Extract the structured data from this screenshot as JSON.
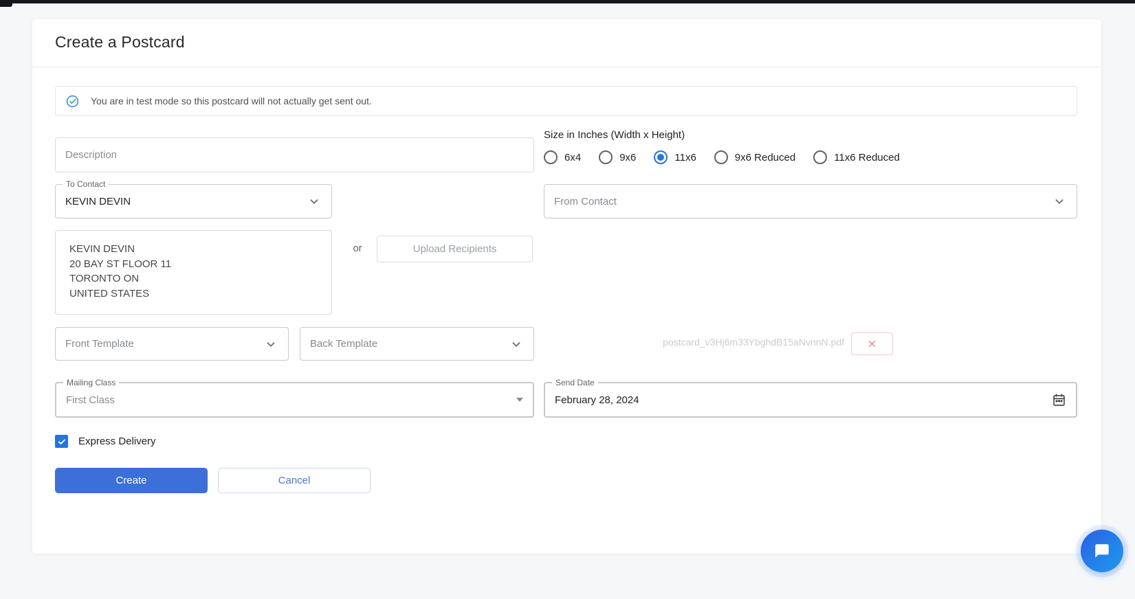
{
  "page": {
    "title": "Create a Postcard"
  },
  "alert": {
    "text": "You are in test mode so this postcard will not actually get sent out."
  },
  "description": {
    "placeholder": "Description"
  },
  "size": {
    "label": "Size in Inches (Width x Height)",
    "options": [
      {
        "label": "6x4",
        "selected": false
      },
      {
        "label": "9x6",
        "selected": false
      },
      {
        "label": "11x6",
        "selected": true
      },
      {
        "label": "9x6 Reduced",
        "selected": false
      },
      {
        "label": "11x6 Reduced",
        "selected": false
      }
    ]
  },
  "to_contact": {
    "label": "To Contact",
    "value": "KEVIN DEVIN"
  },
  "from_contact": {
    "placeholder": "From Contact"
  },
  "recipient_preview": {
    "lines": [
      "KEVIN DEVIN",
      "20 BAY ST FLOOR 11",
      "TORONTO ON",
      "UNITED STATES"
    ]
  },
  "or_label": "or",
  "upload_recipients": {
    "label": "Upload Recipients"
  },
  "front_template": {
    "placeholder": "Front Template"
  },
  "back_template": {
    "placeholder": "Back Template"
  },
  "uploaded_file": {
    "name": "postcard_v3Hj6m33YbghdB15aNvnnN.pdf"
  },
  "mailing_class": {
    "label": "Mailing Class",
    "value": "First Class"
  },
  "send_date": {
    "label": "Send Date",
    "value": "February 28, 2024"
  },
  "express_delivery": {
    "label": "Express Delivery",
    "checked": true
  },
  "actions": {
    "create": "Create",
    "cancel": "Cancel"
  },
  "icons": {
    "alert": "check-circle-icon",
    "selects": "chevron-down-icon",
    "mailing_class": "caret-down-icon",
    "send_date": "calendar-icon",
    "file_remove": "x-icon",
    "chat": "chat-bubble-icon"
  },
  "colors": {
    "accent_blue": "#2374e1",
    "create_button_blue": "#3c6fd8",
    "cancel_text_blue": "#4a79d9",
    "danger_red": "#ee8090",
    "test_mode_icon_blue": "#4596d8",
    "chat_gradient_start": "#2b5fe3",
    "chat_gradient_end": "#1e9bf0"
  }
}
